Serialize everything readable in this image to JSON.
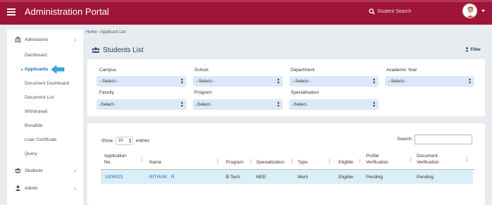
{
  "header": {
    "title": "Administration Portal",
    "search_placeholder": "Student Search",
    "accent": "#9e1538"
  },
  "sidebar": {
    "sections": [
      {
        "label": "Admissions",
        "icon": "institution-icon"
      },
      {
        "label": "Students",
        "icon": "users-icon"
      },
      {
        "label": "Admin",
        "icon": "user-icon"
      }
    ],
    "items": [
      {
        "label": "Dashboard"
      },
      {
        "label": "Applicants",
        "active": true
      },
      {
        "label": "Document Dashboard"
      },
      {
        "label": "Document List"
      },
      {
        "label": "Withdrawal"
      },
      {
        "label": "Bonafide"
      },
      {
        "label": "Loan Certificate"
      },
      {
        "label": "Query"
      }
    ]
  },
  "breadcrumb": {
    "home": "Home",
    "separator": "›",
    "current": "Applicant List"
  },
  "page": {
    "title": "Students List",
    "filter_label": "Filter"
  },
  "filters": {
    "campus": {
      "label": "Campus",
      "value": "--Select--"
    },
    "school": {
      "label": "School",
      "value": "--Select--"
    },
    "department": {
      "label": "Department",
      "value": "--Select--"
    },
    "academic_year": {
      "label": "Academic Year",
      "value": "--Select--"
    },
    "faculty": {
      "label": "Faculty",
      "value": "-Select-"
    },
    "program": {
      "label": "Program",
      "value": "-Select-"
    },
    "specialisation": {
      "label": "Specialisation",
      "value": "-Select-"
    }
  },
  "table": {
    "show_label": "Show",
    "entries_value": "10",
    "entries_label": "entries",
    "search_label": "Search:",
    "columns": [
      {
        "line1": "Application",
        "line2": "No."
      },
      {
        "line1": "Name",
        "line2": ""
      },
      {
        "line1": "Program",
        "line2": ""
      },
      {
        "line1": "Specialization",
        "line2": ""
      },
      {
        "line1": "Type",
        "line2": ""
      },
      {
        "line1": "Eligible",
        "line2": ""
      },
      {
        "line1": "Profile",
        "line2": "Verification"
      },
      {
        "line1": "Document",
        "line2": "Verification"
      }
    ],
    "rows": [
      [
        "1000023",
        "RITHVIK . R",
        "B.Tech",
        "MEE",
        "Merit",
        "Eligible",
        "Pending",
        "Pending"
      ]
    ]
  }
}
